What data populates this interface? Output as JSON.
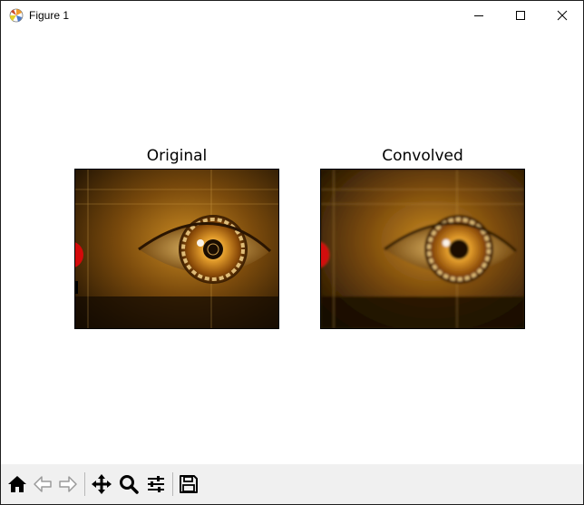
{
  "window": {
    "title": "Figure 1"
  },
  "subplots": [
    {
      "title": "Original",
      "image": "eye-closeup-golden"
    },
    {
      "title": "Convolved",
      "image": "eye-closeup-golden-blurred"
    }
  ],
  "icons": {
    "app": "matplotlib-icon",
    "minimize": "minimize-icon",
    "maximize": "maximize-icon",
    "close": "close-icon",
    "toolbar": [
      "home-icon",
      "back-arrow-icon",
      "forward-arrow-icon",
      "pan-icon",
      "zoom-icon",
      "configure-subplots-icon",
      "save-icon"
    ]
  },
  "colors": {
    "image_highlight": "#f4c24a",
    "image_dark": "#1a0f02",
    "red_object": "#d40a0a"
  }
}
